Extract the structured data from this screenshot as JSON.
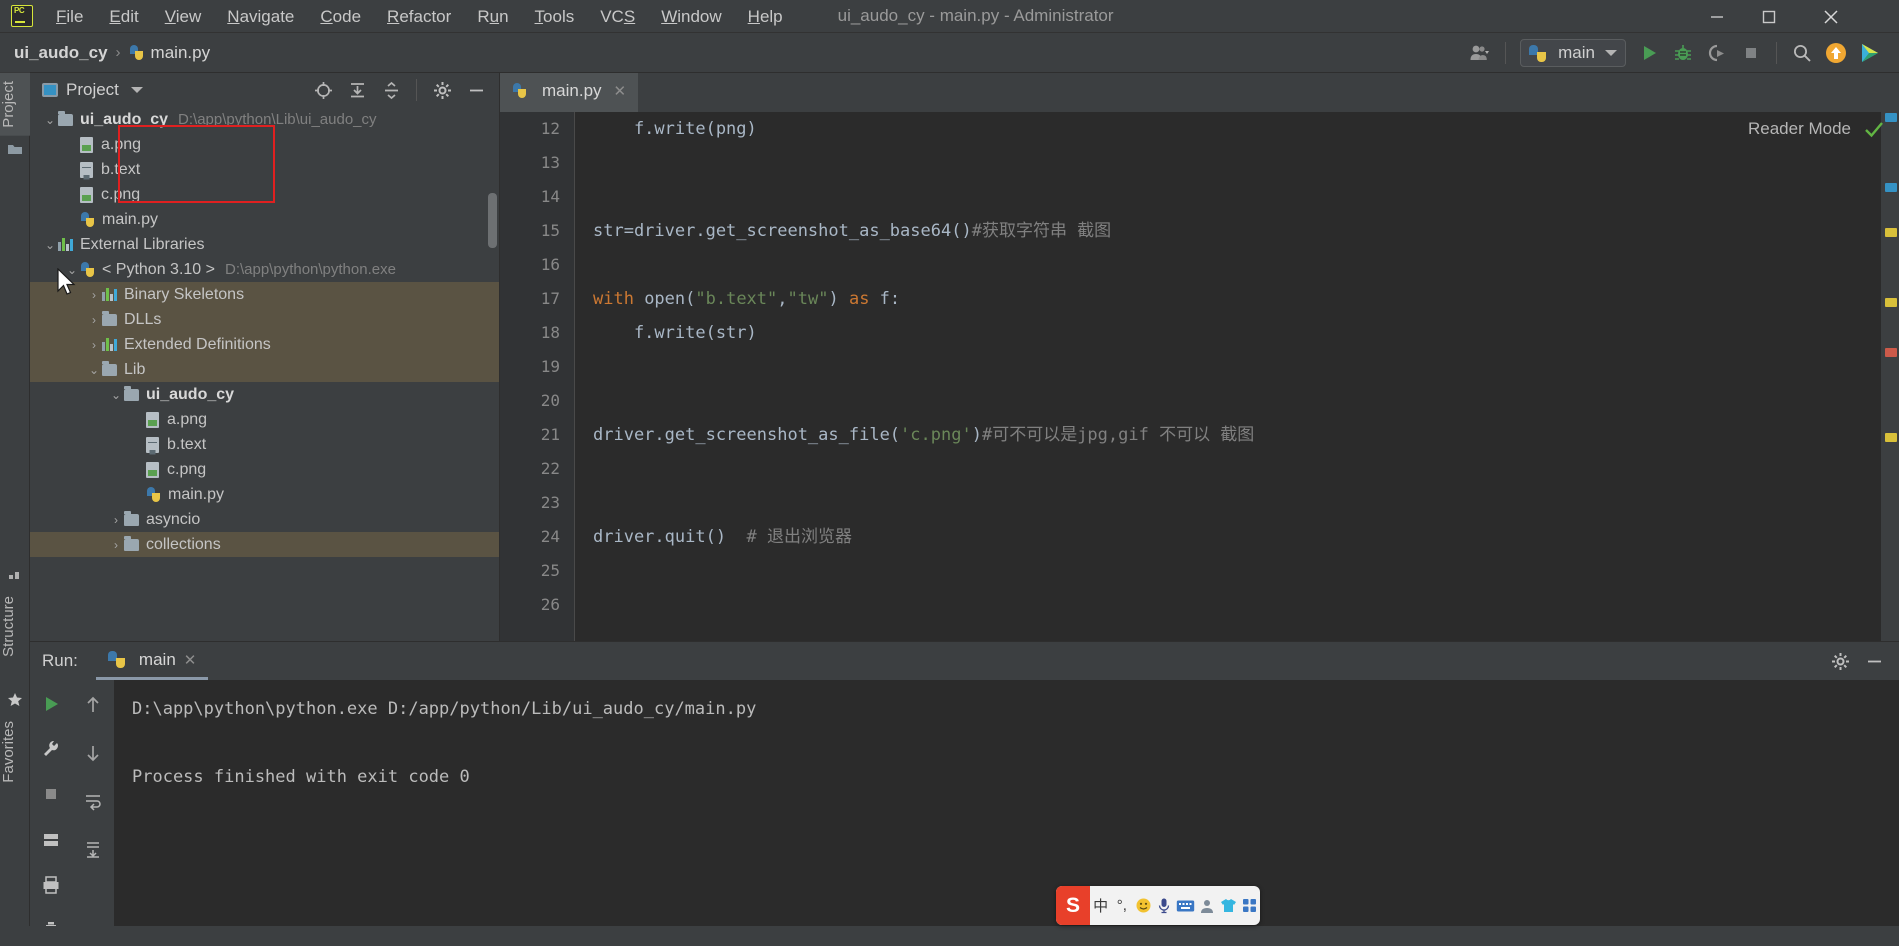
{
  "window": {
    "title": "ui_audo_cy - main.py - Administrator",
    "logo": "pycharm-logo",
    "minimize": "—",
    "maximize": "▢",
    "close": "✕"
  },
  "menu": {
    "items": [
      {
        "label": "File",
        "mnemonic": "F"
      },
      {
        "label": "Edit",
        "mnemonic": "E"
      },
      {
        "label": "View",
        "mnemonic": "V"
      },
      {
        "label": "Navigate",
        "mnemonic": "N"
      },
      {
        "label": "Code",
        "mnemonic": "C"
      },
      {
        "label": "Refactor",
        "mnemonic": "R"
      },
      {
        "label": "Run",
        "mnemonic": "u"
      },
      {
        "label": "Tools",
        "mnemonic": "T"
      },
      {
        "label": "VCS",
        "mnemonic": "S"
      },
      {
        "label": "Window",
        "mnemonic": "W"
      },
      {
        "label": "Help",
        "mnemonic": "H"
      }
    ]
  },
  "navbar": {
    "breadcrumbs": [
      {
        "label": "ui_audo_cy",
        "icon": "folder-icon"
      },
      {
        "label": "main.py",
        "icon": "python-file-icon"
      }
    ],
    "separator": "›",
    "run_config": {
      "label": "main",
      "icon": "python-icon",
      "chevron": "▾"
    },
    "icons": [
      {
        "name": "user-account-icon",
        "glyph": "user"
      },
      {
        "name": "run-icon",
        "glyph": "play"
      },
      {
        "name": "debug-icon",
        "glyph": "bug"
      },
      {
        "name": "run-coverage-icon",
        "glyph": "coverage"
      },
      {
        "name": "stop-icon",
        "glyph": "stop"
      },
      {
        "name": "search-everywhere-icon",
        "glyph": "magnifier"
      },
      {
        "name": "update-project-icon",
        "glyph": "orange-up-arrow"
      },
      {
        "name": "ide-features-icon",
        "glyph": "colored-play"
      }
    ]
  },
  "left_strip": {
    "tabs": [
      {
        "label": "Project",
        "active": true
      },
      {
        "label": "Structure",
        "active": false
      },
      {
        "label": "Favorites",
        "active": false
      }
    ]
  },
  "project_panel": {
    "title": "Project",
    "chevron": "▾",
    "tools": [
      {
        "name": "select-opened-file-icon",
        "glyph": "⊕"
      },
      {
        "name": "expand-all-icon",
        "glyph": "⤓"
      },
      {
        "name": "collapse-all-icon",
        "glyph": "⤒"
      },
      {
        "name": "settings-gear-icon",
        "glyph": "⚙"
      },
      {
        "name": "hide-panel-icon",
        "glyph": "—"
      }
    ],
    "tree": [
      {
        "id": "root",
        "depth": 0,
        "chevron": "⌄",
        "icon": "folder-icon",
        "label": "ui_audo_cy",
        "bold": true,
        "path": "D:\\app\\python\\Lib\\ui_audo_cy",
        "highlight": false
      },
      {
        "id": "a_png_1",
        "depth": 1,
        "chevron": "",
        "icon": "image-file-icon",
        "label": "a.png",
        "bold": false,
        "path": "",
        "highlight": false
      },
      {
        "id": "b_text_1",
        "depth": 1,
        "chevron": "",
        "icon": "text-file-icon",
        "label": "b.text",
        "bold": false,
        "path": "",
        "highlight": false
      },
      {
        "id": "c_png_1",
        "depth": 1,
        "chevron": "",
        "icon": "image-file-icon",
        "label": "c.png",
        "bold": false,
        "path": "",
        "highlight": false
      },
      {
        "id": "main_py_1",
        "depth": 1,
        "chevron": "",
        "icon": "python-file-icon",
        "label": "main.py",
        "bold": false,
        "path": "",
        "highlight": false
      },
      {
        "id": "extlibs",
        "depth": 0,
        "chevron": "⌄",
        "icon": "library-icon",
        "label": "External Libraries",
        "bold": false,
        "path": "",
        "highlight": false
      },
      {
        "id": "py310",
        "depth": 1,
        "chevron": "⌄",
        "icon": "python-icon",
        "label": "< Python 3.10 >",
        "bold": false,
        "path": "D:\\app\\python\\python.exe",
        "highlight": false
      },
      {
        "id": "binskel",
        "depth": 2,
        "chevron": "›",
        "icon": "library-icon",
        "label": "Binary Skeletons",
        "bold": false,
        "path": "",
        "highlight": true
      },
      {
        "id": "dlls",
        "depth": 2,
        "chevron": "›",
        "icon": "folder-icon",
        "label": "DLLs",
        "bold": false,
        "path": "",
        "highlight": true
      },
      {
        "id": "extdefs",
        "depth": 2,
        "chevron": "›",
        "icon": "library-icon",
        "label": "Extended Definitions",
        "bold": false,
        "path": "",
        "highlight": true
      },
      {
        "id": "lib",
        "depth": 2,
        "chevron": "⌄",
        "icon": "folder-icon",
        "label": "Lib",
        "bold": false,
        "path": "",
        "highlight": true
      },
      {
        "id": "uiaudocy2",
        "depth": 3,
        "chevron": "⌄",
        "icon": "folder-icon",
        "label": "ui_audo_cy",
        "bold": true,
        "path": "",
        "highlight": false
      },
      {
        "id": "a_png_2",
        "depth": 4,
        "chevron": "",
        "icon": "image-file-icon",
        "label": "a.png",
        "bold": false,
        "path": "",
        "highlight": false
      },
      {
        "id": "b_text_2",
        "depth": 4,
        "chevron": "",
        "icon": "text-file-icon",
        "label": "b.text",
        "bold": false,
        "path": "",
        "highlight": false
      },
      {
        "id": "c_png_2",
        "depth": 4,
        "chevron": "",
        "icon": "image-file-icon",
        "label": "c.png",
        "bold": false,
        "path": "",
        "highlight": false
      },
      {
        "id": "main_py_2",
        "depth": 4,
        "chevron": "",
        "icon": "python-file-icon",
        "label": "main.py",
        "bold": false,
        "path": "",
        "highlight": false
      },
      {
        "id": "asyncio",
        "depth": 3,
        "chevron": "›",
        "icon": "folder-icon",
        "label": "asyncio",
        "bold": false,
        "path": "",
        "highlight": false
      },
      {
        "id": "collections",
        "depth": 3,
        "chevron": "›",
        "icon": "folder-icon",
        "label": "collections",
        "bold": false,
        "path": "",
        "highlight": true
      }
    ]
  },
  "editor": {
    "tabs": [
      {
        "label": "main.py",
        "icon": "python-file-icon",
        "close": "✕",
        "active": true
      }
    ],
    "reader_mode": {
      "label": "Reader Mode",
      "check": "✓"
    },
    "first_line_number": 12,
    "lines": [
      {
        "n": 12,
        "tokens": [
          {
            "t": "    f.write(png)",
            "c": "def"
          }
        ]
      },
      {
        "n": 13,
        "tokens": []
      },
      {
        "n": 14,
        "tokens": []
      },
      {
        "n": 15,
        "tokens": [
          {
            "t": "str=driver.get_screenshot_as_base64()",
            "c": "def"
          },
          {
            "t": "#获取字符串 截图",
            "c": "com"
          }
        ]
      },
      {
        "n": 16,
        "tokens": []
      },
      {
        "n": 17,
        "tokens": [
          {
            "t": "with ",
            "c": "kw"
          },
          {
            "t": "open(",
            "c": "def"
          },
          {
            "t": "\"b.text\"",
            "c": "str"
          },
          {
            "t": ",",
            "c": "def"
          },
          {
            "t": "\"tw\"",
            "c": "str"
          },
          {
            "t": ") ",
            "c": "def"
          },
          {
            "t": "as",
            "c": "kw"
          },
          {
            "t": " f:",
            "c": "def"
          }
        ]
      },
      {
        "n": 18,
        "tokens": [
          {
            "t": "    f.write(str)",
            "c": "def"
          }
        ]
      },
      {
        "n": 19,
        "tokens": []
      },
      {
        "n": 20,
        "tokens": []
      },
      {
        "n": 21,
        "tokens": [
          {
            "t": "driver.get_screenshot_as_file(",
            "c": "def"
          },
          {
            "t": "'c.png'",
            "c": "str"
          },
          {
            "t": ")",
            "c": "def"
          },
          {
            "t": "#可不可以是jpg,gif 不可以 截图",
            "c": "com"
          }
        ]
      },
      {
        "n": 22,
        "tokens": []
      },
      {
        "n": 23,
        "tokens": []
      },
      {
        "n": 24,
        "tokens": [
          {
            "t": "driver.quit()",
            "c": "def"
          },
          {
            "t": "  # 退出浏览器",
            "c": "com"
          }
        ]
      },
      {
        "n": 25,
        "tokens": []
      },
      {
        "n": 26,
        "tokens": []
      }
    ]
  },
  "run_panel": {
    "label": "Run:",
    "tab": {
      "label": "main",
      "icon": "python-icon",
      "close": "✕"
    },
    "header_icons": [
      {
        "name": "settings-gear-icon",
        "glyph": "⚙"
      },
      {
        "name": "hide-panel-icon",
        "glyph": "—"
      }
    ],
    "side_icons_1": [
      {
        "name": "rerun-icon",
        "glyph": "play"
      },
      {
        "name": "settings-wrench-icon",
        "glyph": "wrench"
      },
      {
        "name": "stop-icon",
        "glyph": "stop"
      },
      {
        "name": "layout-icon",
        "glyph": "grid"
      },
      {
        "name": "print-icon",
        "glyph": "printer"
      },
      {
        "name": "delete-icon",
        "glyph": "trash"
      }
    ],
    "side_icons_2": [
      {
        "name": "up-arrow-icon",
        "glyph": "↑"
      },
      {
        "name": "down-arrow-icon",
        "glyph": "↓"
      },
      {
        "name": "soft-wrap-icon",
        "glyph": "⇥"
      },
      {
        "name": "scroll-end-icon",
        "glyph": "⇟"
      }
    ],
    "console": [
      "D:\\app\\python\\python.exe D:/app/python/Lib/ui_audo_cy/main.py",
      "",
      "Process finished with exit code 0"
    ]
  },
  "ime_bar": {
    "logo": "S",
    "items": [
      {
        "name": "language-mode-icon",
        "glyph": "中"
      },
      {
        "name": "punctuation-icon",
        "glyph": "°,"
      },
      {
        "name": "emoji-icon",
        "glyph": "☺"
      },
      {
        "name": "voice-input-icon",
        "glyph": "🎤"
      },
      {
        "name": "soft-keyboard-icon",
        "glyph": "⌨"
      },
      {
        "name": "user-icon",
        "glyph": "👤"
      },
      {
        "name": "skin-icon",
        "glyph": "👔"
      },
      {
        "name": "toolbox-icon",
        "glyph": "▦"
      }
    ]
  },
  "colors": {
    "bg_panel": "#3c3f41",
    "bg_editor": "#2b2b2b",
    "accent_highlight": "#5a5343",
    "annotation_red": "#e02020",
    "string_green": "#6a8759",
    "keyword_orange": "#cc7832",
    "comment_gray": "#808080",
    "run_green": "#53a653"
  }
}
